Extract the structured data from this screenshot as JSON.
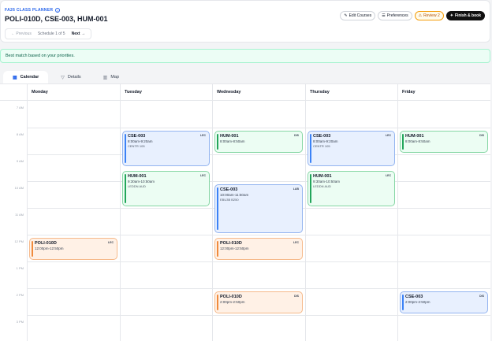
{
  "header": {
    "term_label": "FA26 CLASS PLANNER",
    "title": "POLI-010D, CSE-003, HUM-001",
    "prev_label": "← Previous",
    "schedule_status": "Schedule 1 of 5",
    "next_label": "Next →"
  },
  "toolbar": {
    "edit_courses": "Edit Courses",
    "preferences": "Preferences",
    "review": "Review 2",
    "finish": "Finish & book"
  },
  "banner": {
    "text": "Best match based on your priorities."
  },
  "tabs": [
    {
      "label": "Calendar",
      "icon": "calendar-icon"
    },
    {
      "label": "Details",
      "icon": "filter-icon"
    },
    {
      "label": "Map",
      "icon": "map-icon"
    }
  ],
  "days": [
    "Monday",
    "Tuesday",
    "Wednesday",
    "Thursday",
    "Friday"
  ],
  "times": [
    "7 AM",
    "8 AM",
    "9 AM",
    "10 AM",
    "11 AM",
    "12 PM",
    "1 PM",
    "2 PM",
    "3 PM"
  ],
  "events": [
    {
      "day": "Tuesday",
      "course": "CSE-003",
      "type": "LEC",
      "time": "8:00am-9:20am",
      "room": "CENTR 105",
      "color": "blue"
    },
    {
      "day": "Tuesday",
      "course": "HUM-001",
      "type": "LEC",
      "time": "9:30am-10:50am",
      "room": "LEDDN AUD",
      "color": "green"
    },
    {
      "day": "Wednesday",
      "course": "HUM-001",
      "type": "DIS",
      "time": "8:00am-8:50am",
      "room": "",
      "color": "green"
    },
    {
      "day": "Wednesday",
      "course": "CSE-003",
      "type": "LAB",
      "time": "10:00am-11:50am",
      "room": "EBU3B B250",
      "color": "blue"
    },
    {
      "day": "Wednesday",
      "course": "POLI-010D",
      "type": "LEC",
      "time": "12:00pm-12:50pm",
      "room": "",
      "color": "orange"
    },
    {
      "day": "Wednesday",
      "course": "POLI-010D",
      "type": "DIS",
      "time": "2:00pm-2:50pm",
      "room": "",
      "color": "orange"
    },
    {
      "day": "Thursday",
      "course": "CSE-003",
      "type": "LEC",
      "time": "8:00am-9:20am",
      "room": "CENTR 105",
      "color": "blue"
    },
    {
      "day": "Thursday",
      "course": "HUM-001",
      "type": "LEC",
      "time": "9:30am-10:50am",
      "room": "LEDDN AUD",
      "color": "green"
    },
    {
      "day": "Monday",
      "course": "POLI-010D",
      "type": "LEC",
      "time": "12:00pm-12:50pm",
      "room": "",
      "color": "orange"
    },
    {
      "day": "Friday",
      "course": "HUM-001",
      "type": "DIS",
      "time": "8:00am-8:50am",
      "room": "",
      "color": "green"
    },
    {
      "day": "Friday",
      "course": "CSE-003",
      "type": "DIS",
      "time": "2:00pm-2:50pm",
      "room": "",
      "color": "blue"
    }
  ]
}
